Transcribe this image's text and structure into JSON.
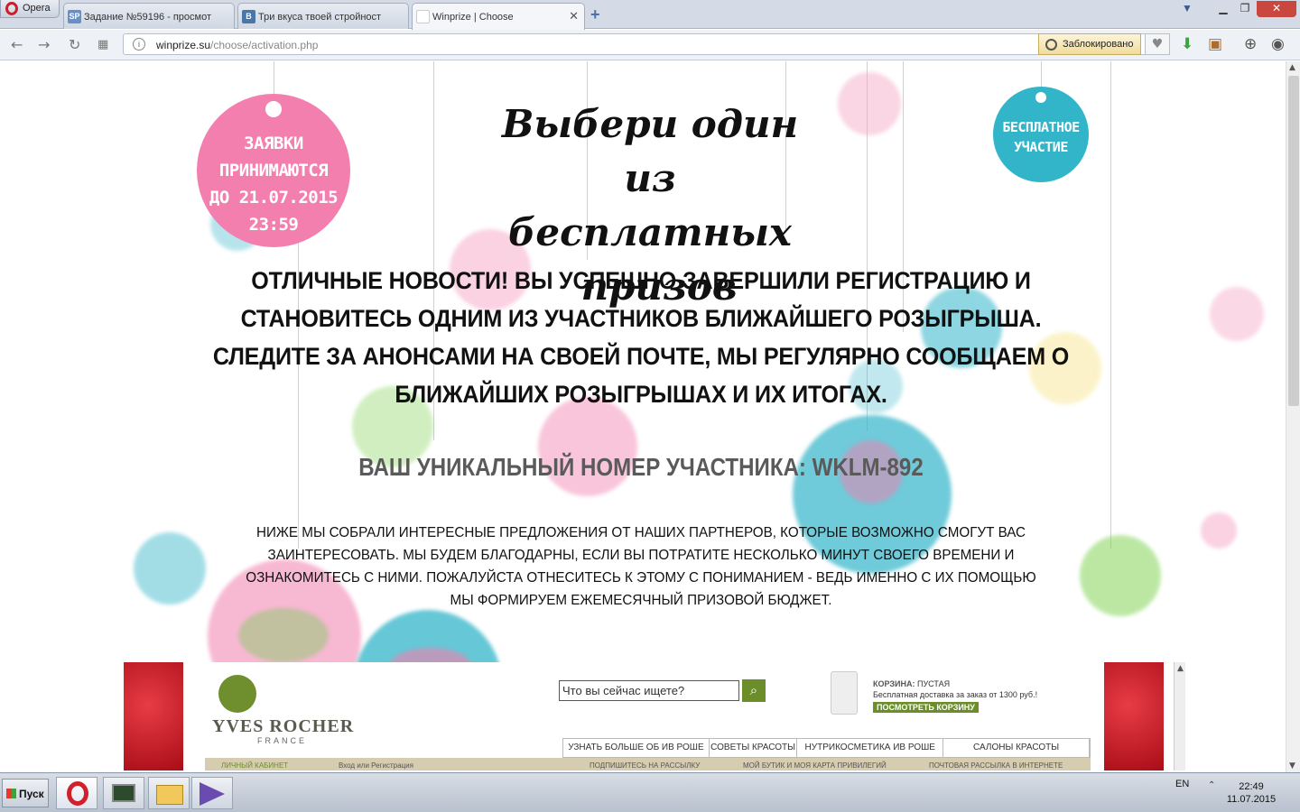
{
  "browser": {
    "menu_label": "Opera",
    "tabs": [
      {
        "label": "Задание №59196 - просмот",
        "favicon": "SP"
      },
      {
        "label": "Три вкуса твоей стройност",
        "favicon": "B"
      },
      {
        "label": "Winprize | Choose",
        "favicon": ""
      }
    ],
    "url_domain": "winprize.su",
    "url_path": "/choose/activation.php",
    "blocked_label": "Заблокировано"
  },
  "page": {
    "badge_deadline": [
      "ЗАЯВКИ",
      "ПРИНИМАЮТСЯ",
      "ДО 21.07.2015",
      "23:59"
    ],
    "badge_free": [
      "БЕСПЛАТНОЕ",
      "УЧАСТИЕ"
    ],
    "title": [
      "Выбери один из",
      "бесплатных",
      "призов"
    ],
    "news": [
      "ОТЛИЧНЫЕ НОВОСТИ! ВЫ УСПЕШНО ЗАВЕРШИЛИ РЕГИСТРАЦИЮ И",
      "СТАНОВИТЕСЬ ОДНИМ ИЗ УЧАСТНИКОВ БЛИЖАЙШЕГО РОЗЫГРЫША.",
      "СЛЕДИТЕ ЗА АНОНСАМИ НА СВОЕЙ ПОЧТЕ, МЫ РЕГУЛЯРНО СООБЩАЕМ О",
      "БЛИЖАЙШИХ РОЗЫГРЫШАХ И ИХ ИТОГАХ."
    ],
    "participant_id": "ВАШ УНИКАЛЬНЫЙ НОМЕР УЧАСТНИКА: WKLM-892",
    "partners": [
      "НИЖЕ МЫ СОБРАЛИ ИНТЕРЕСНЫЕ ПРЕДЛОЖЕНИЯ ОТ НАШИХ ПАРТНЕРОВ, КОТОРЫЕ ВОЗМОЖНО СМОГУТ ВАС",
      "ЗАИНТЕРЕСОВАТЬ. МЫ БУДЕМ БЛАГОДАРНЫ, ЕСЛИ ВЫ ПОТРАТИТЕ НЕСКОЛЬКО МИНУТ СВОЕГО ВРЕМЕНИ И",
      "ОЗНАКОМИТЕСЬ С НИМИ. ПОЖАЛУЙСТА ОТНЕСИТЕСЬ К ЭТОМУ С ПОНИМАНИЕМ - ВЕДЬ ИМЕННО С ИХ ПОМОЩЬЮ",
      "МЫ ФОРМИРУЕМ ЕЖЕМЕСЯЧНЫЙ ПРИЗОВОЙ БЮДЖЕТ."
    ]
  },
  "partner_site": {
    "brand": "YVES ROCHER",
    "brand_sub": "FRANCE",
    "search_placeholder": "Что вы сейчас ищете?",
    "cart_label": "КОРЗИНА:",
    "cart_status": "ПУСТАЯ",
    "cart_note": "Бесплатная доставка за заказ от 1300 руб.!",
    "cart_button": "ПОСМОТРЕТЬ КОРЗИНУ",
    "nav": [
      "УЗНАТЬ БОЛЬШЕ ОБ ИВ РОШЕ",
      "СОВЕТЫ КРАСОТЫ",
      "НУТРИКОСМЕТИКА ИВ РОШЕ",
      "САЛОНЫ КРАСОТЫ"
    ],
    "subnav": [
      "ЛИЧНЫЙ КАБИНЕТ",
      "Вход или Регистрация",
      "ПОДПИШИТЕСЬ НА РАССЫЛКУ",
      "МОЙ БУТИК И МОЯ КАРТА ПРИВИЛЕГИЙ",
      "ПОЧТОВАЯ РАССЫЛКА В ИНТЕРНЕТЕ"
    ]
  },
  "taskbar": {
    "start_label": "Пуск",
    "lang": "EN",
    "time": "22:49",
    "date": "11.07.2015"
  },
  "colors": {
    "pink": "#f27fae",
    "teal": "#33b5c9",
    "brand_green": "#6b8e2a"
  }
}
